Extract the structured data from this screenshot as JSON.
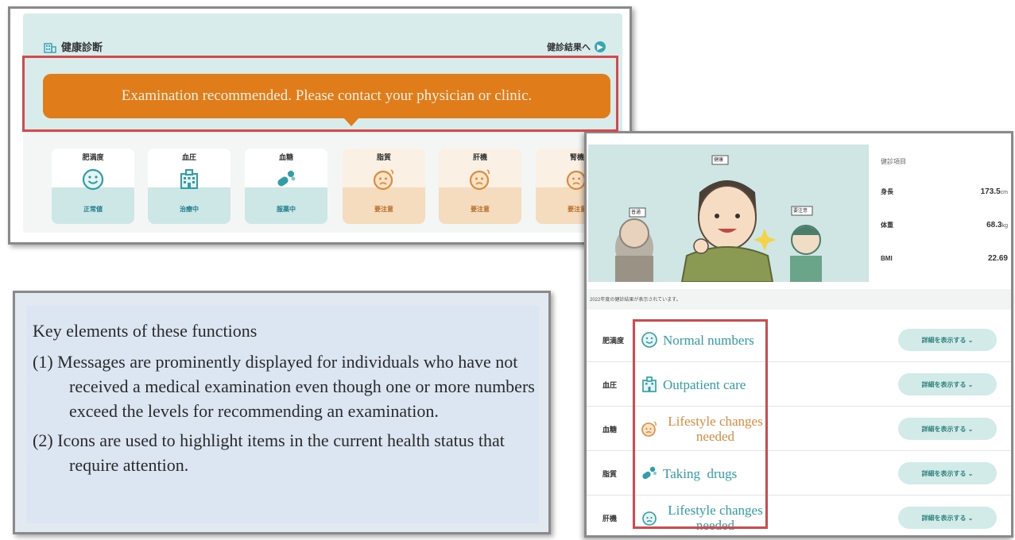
{
  "top_panel": {
    "title": "健康診断",
    "link_label": "健診結果へ",
    "banner_message": "Examination recommended. Please contact your physician or clinic.",
    "cards": [
      {
        "label": "肥満度",
        "status": "正常値",
        "icon": "smile-face-icon",
        "tone": "teal"
      },
      {
        "label": "血圧",
        "status": "治療中",
        "icon": "hospital-icon",
        "tone": "teal"
      },
      {
        "label": "血糖",
        "status": "服薬中",
        "icon": "pill-icon",
        "tone": "teal"
      },
      {
        "label": "脂質",
        "status": "要注意",
        "icon": "worried-face-icon",
        "tone": "warn"
      },
      {
        "label": "肝機",
        "status": "要注意",
        "icon": "worried-face-icon",
        "tone": "warn"
      },
      {
        "label": "腎機",
        "status": "要注意",
        "icon": "worried-face-icon",
        "tone": "warn"
      }
    ]
  },
  "key_panel": {
    "heading": "Key elements of these functions",
    "items": [
      "(1) Messages are prominently displayed for individuals who have not received a medical examination even though one or more numbers exceed the levels for recommending an examination.",
      "(2) Icons are used to highlight items in the current health status that require attention."
    ]
  },
  "right_panel": {
    "hero_tags": [
      "健康",
      "普通",
      "要注意"
    ],
    "metrics_title": "健診項目",
    "metrics": [
      {
        "label": "身長",
        "value": "173.5",
        "unit": "cm"
      },
      {
        "label": "体重",
        "value": "68.3",
        "unit": "kg"
      },
      {
        "label": "BMI",
        "value": "22.69",
        "unit": ""
      }
    ],
    "note": "2022年度の健診結果が表示されています。",
    "rows": [
      {
        "label": "肥満度",
        "status": "Normal numbers",
        "tone": "teal",
        "icon": "smile-face-icon",
        "button": "詳細を表示する ⌄"
      },
      {
        "label": "血圧",
        "status": "Outpatient care",
        "tone": "teal",
        "icon": "hospital-icon",
        "button": "詳細を表示する ⌄"
      },
      {
        "label": "血糖",
        "status": "Lifestyle changes needed",
        "tone": "orange",
        "icon": "worried-face-icon",
        "button": "詳細を表示する ⌄"
      },
      {
        "label": "脂質",
        "status": "Taking  drugs",
        "tone": "teal",
        "icon": "pill-icon",
        "button": "詳細を表示する ⌄"
      },
      {
        "label": "肝機",
        "status": "Lifestyle changes needed",
        "tone": "teal",
        "icon": "worried-face-icon",
        "button": "詳細を表示する ⌄"
      }
    ]
  },
  "colors": {
    "accent_orange": "#e07c1a",
    "teal": "#2f9ea6",
    "highlight_red": "#d5494d",
    "teal_bg": "#d8ecec"
  }
}
